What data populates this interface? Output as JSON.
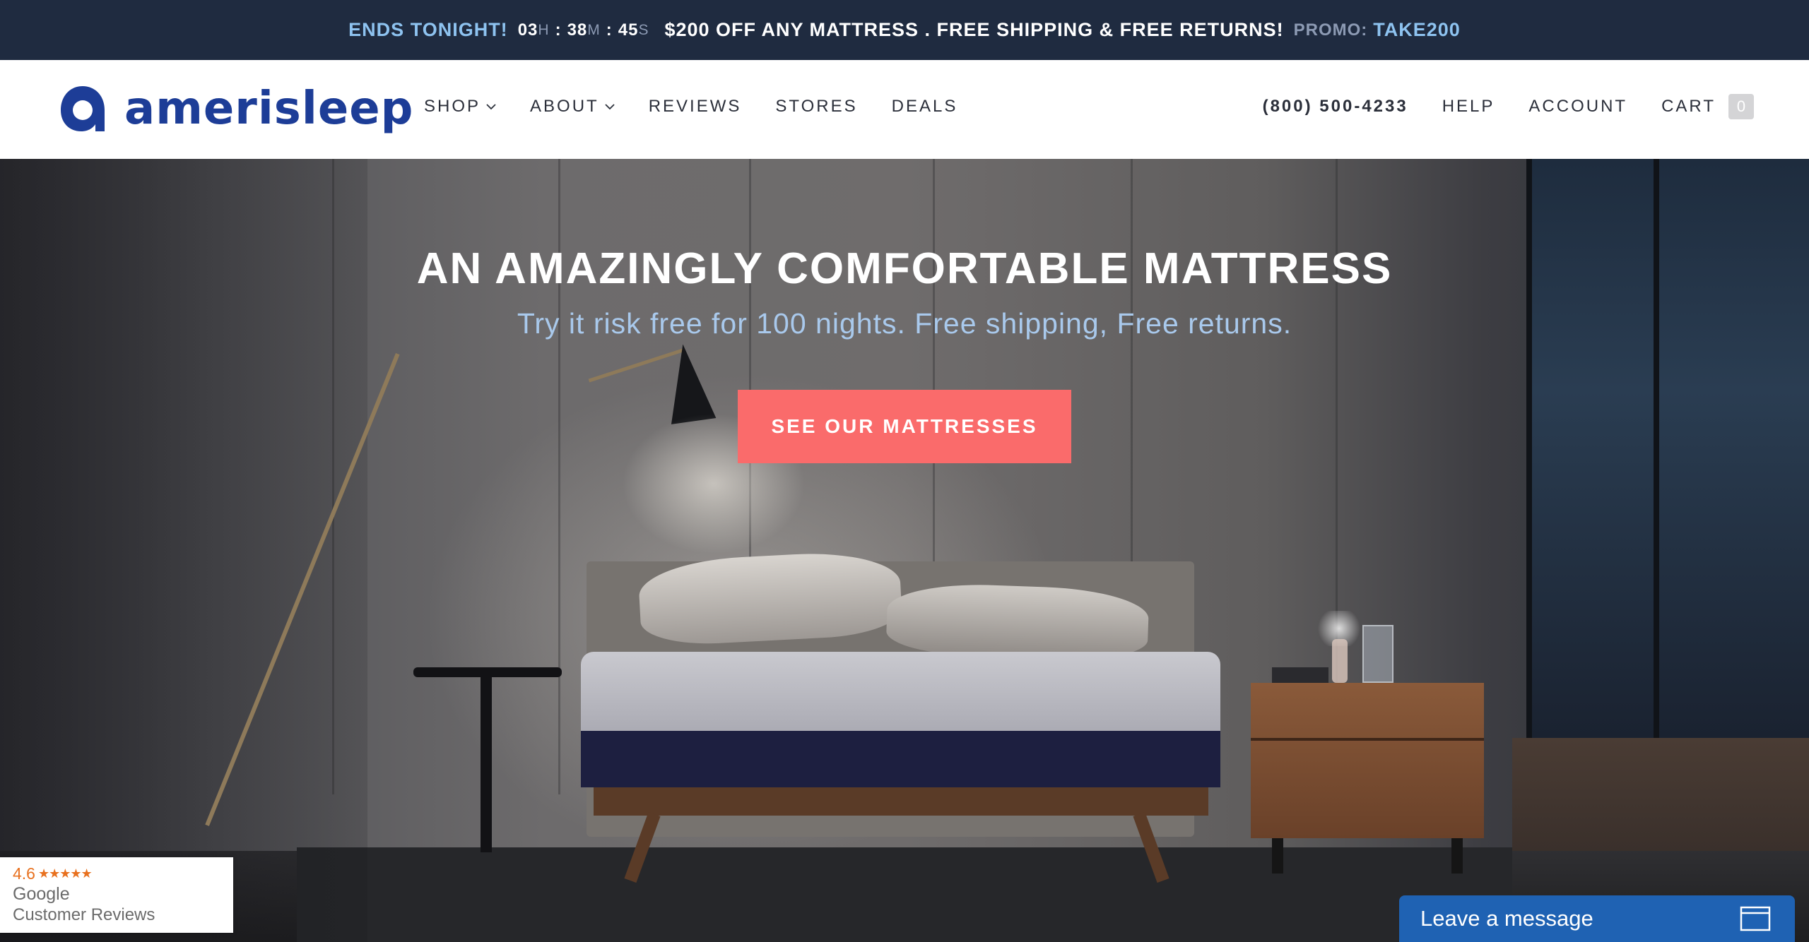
{
  "promo": {
    "ends": "ENDS TONIGHT!",
    "hours": "03",
    "hours_unit": "H",
    "minutes": "38",
    "minutes_unit": "M",
    "seconds": "45",
    "seconds_unit": "S",
    "separator": ":",
    "offer": "$200 OFF ANY MATTRESS . FREE SHIPPING & FREE RETURNS!",
    "code_label": "PROMO:",
    "code": "TAKE200"
  },
  "header": {
    "logo_text": "amerisleep",
    "nav": [
      {
        "label": "SHOP",
        "dropdown": true
      },
      {
        "label": "ABOUT",
        "dropdown": true
      },
      {
        "label": "REVIEWS",
        "dropdown": false
      },
      {
        "label": "STORES",
        "dropdown": false
      },
      {
        "label": "DEALS",
        "dropdown": false
      }
    ],
    "phone": "(800) 500-4233",
    "help": "HELP",
    "account": "ACCOUNT",
    "cart": "CART",
    "cart_count": "0"
  },
  "hero": {
    "title": "AN AMAZINGLY COMFORTABLE MATTRESS",
    "subtitle": "Try it risk free for 100 nights. Free shipping, Free returns.",
    "cta": "SEE OUR MATTRESSES"
  },
  "reviews_badge": {
    "score": "4.6",
    "stars": "★★★★★",
    "source": "Google",
    "label": "Customer Reviews"
  },
  "chat": {
    "label": "Leave a message",
    "icon": "chat-window-icon"
  },
  "colors": {
    "promo_bg": "#1f2b40",
    "promo_accent": "#8ec3f0",
    "brand": "#1d3d97",
    "cta": "#fa6b6b",
    "chat": "#1f62b3",
    "review_orange": "#e8711f"
  }
}
